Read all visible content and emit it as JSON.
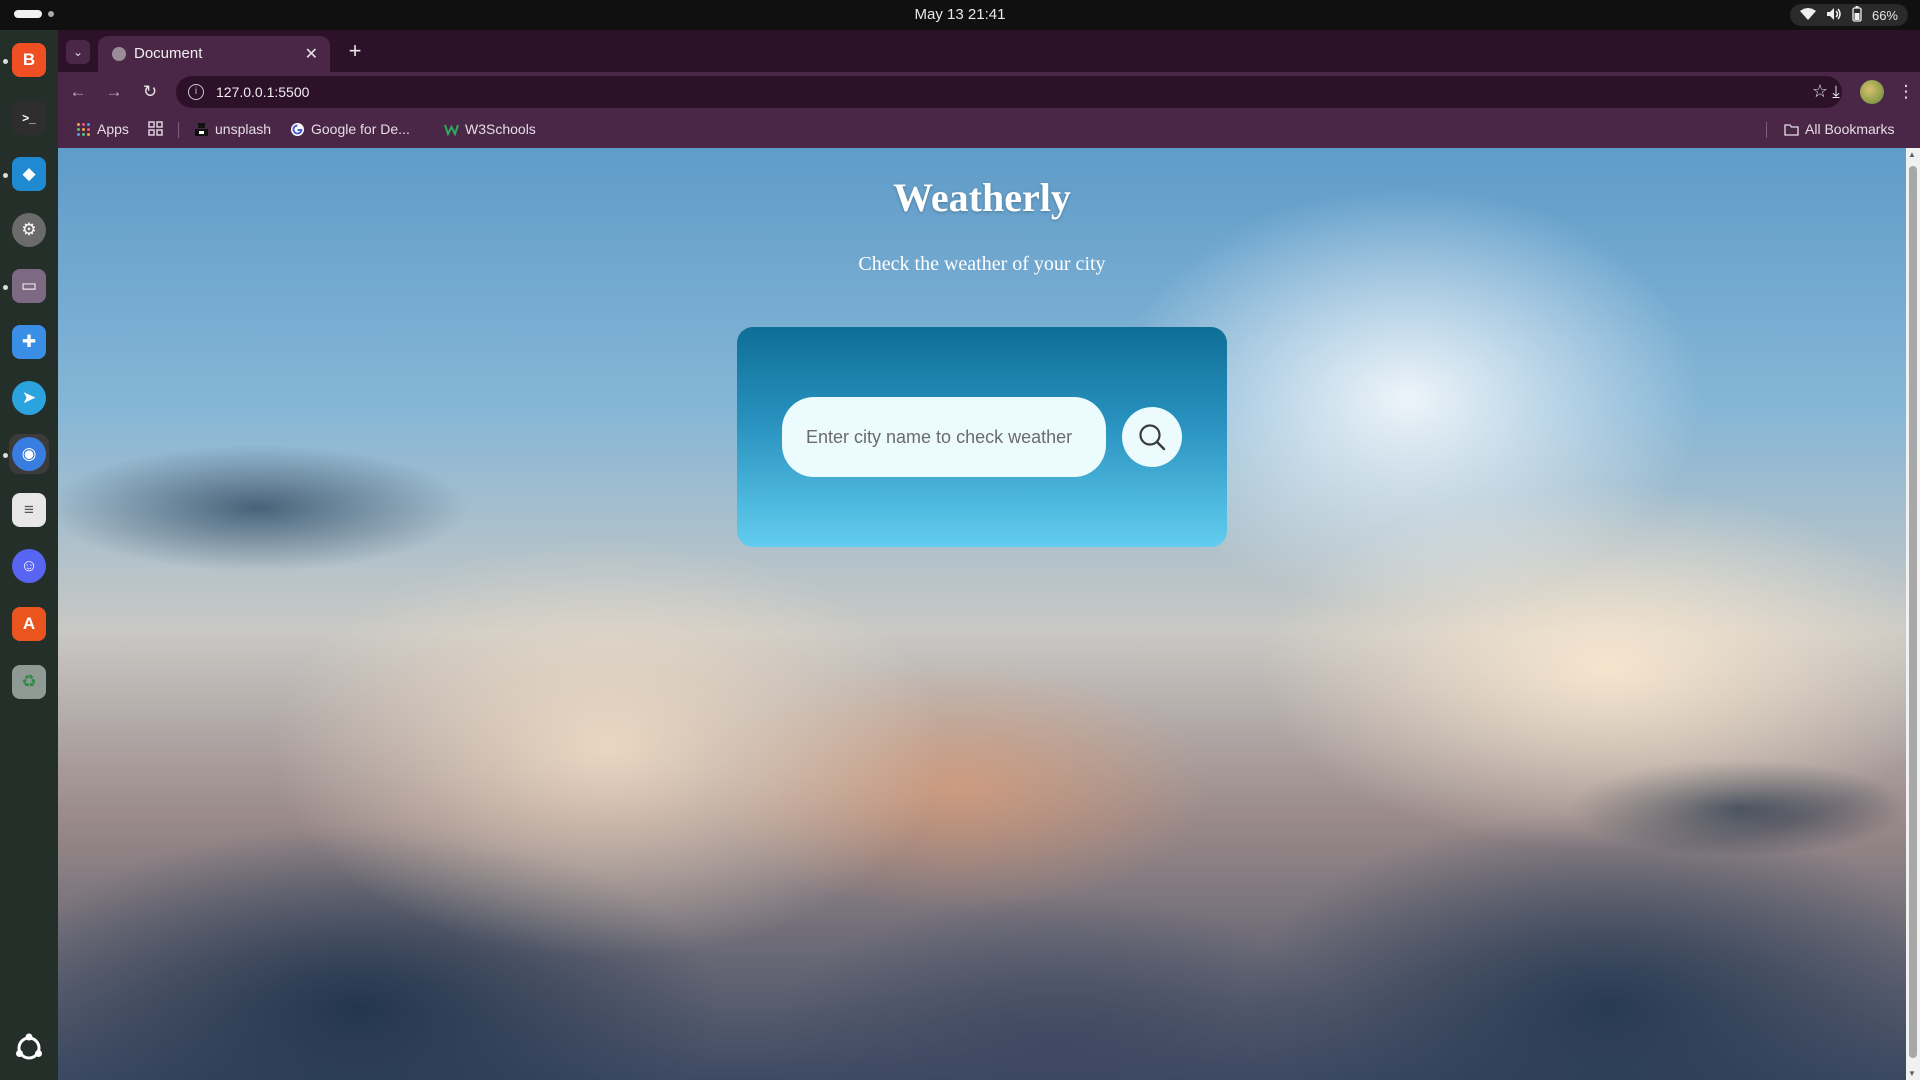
{
  "system": {
    "clock": "May 13  21:41",
    "battery": "66%"
  },
  "dock": {
    "items": [
      {
        "name": "brave",
        "color": "#f04e23",
        "glyph": "B"
      },
      {
        "name": "terminal",
        "color": "#2e2e2e",
        "glyph": ">_"
      },
      {
        "name": "vscode",
        "color": "#1f8ad2",
        "glyph": "◆"
      },
      {
        "name": "settings",
        "color": "#6b6b6b",
        "glyph": "⚙"
      },
      {
        "name": "files",
        "color": "#7d6a82",
        "glyph": "▭"
      },
      {
        "name": "extensions",
        "color": "#3b8ee6",
        "glyph": "✚"
      },
      {
        "name": "telegram",
        "color": "#2aa3df",
        "glyph": "➤"
      },
      {
        "name": "chrome",
        "color": "#3a7de0",
        "glyph": "◉"
      },
      {
        "name": "text-editor",
        "color": "#e7e7e7",
        "glyph": "≡"
      },
      {
        "name": "discord",
        "color": "#5865f2",
        "glyph": "☺"
      },
      {
        "name": "app-center",
        "color": "#e9541f",
        "glyph": "A"
      },
      {
        "name": "trash",
        "color": "#8f9a94",
        "glyph": "♻"
      }
    ]
  },
  "browser": {
    "tab_title": "Document",
    "url": "127.0.0.1:5500",
    "bookmarks": {
      "apps": "Apps",
      "unsplash": "unsplash",
      "google": "Google for De...",
      "w3schools": "W3Schools",
      "all": "All Bookmarks"
    }
  },
  "page": {
    "title": "Weatherly",
    "subtitle": "Check the weather of your city",
    "search_placeholder": "Enter city name to check weather"
  }
}
